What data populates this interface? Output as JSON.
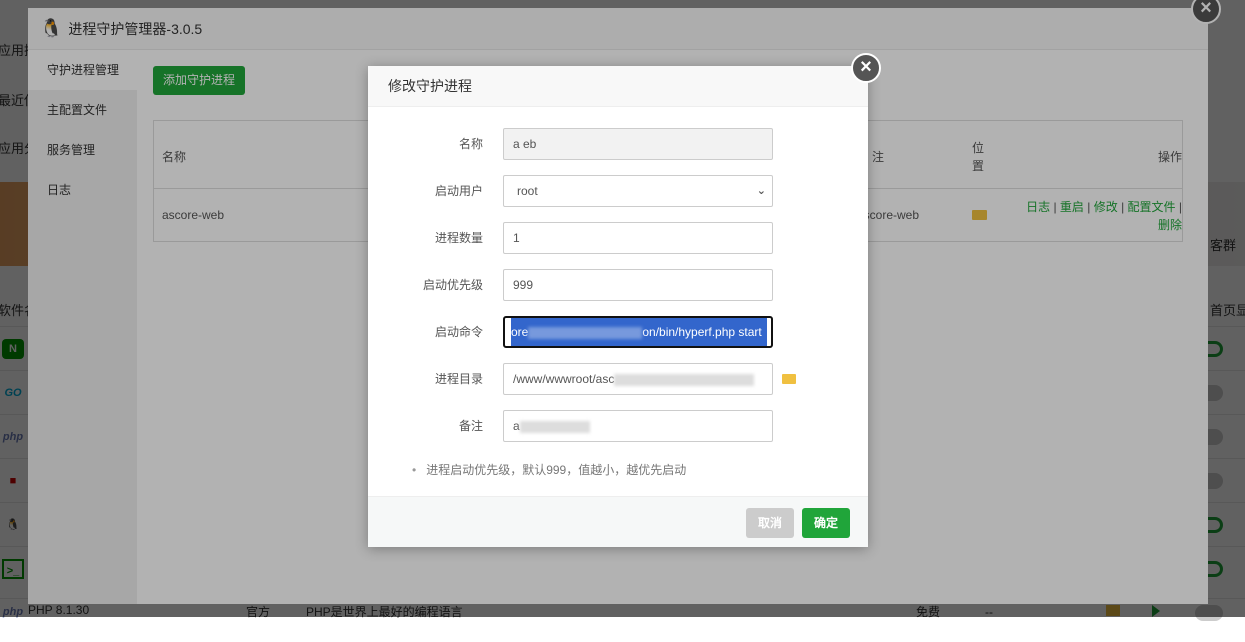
{
  "background": {
    "left_labels": [
      "应用搜索",
      "最近使用",
      "应用分类"
    ],
    "banner_text": "客群（年",
    "column_software": "软件名称",
    "column_home": "首页显示",
    "soft_icons": [
      "nginx-icon",
      "go-icon",
      "php-icon",
      "redis-icon",
      "linux-icon",
      "terminal-icon"
    ],
    "soft_icon_text": [
      "N",
      "GO",
      "php",
      "■",
      "🐧",
      ">_"
    ],
    "toggles_on": [
      true,
      false,
      false,
      false,
      true,
      true
    ],
    "bottom_row": {
      "icon": "php",
      "name": "PHP 8.1.30",
      "type": "官方",
      "desc": "PHP是世界上最好的编程语言",
      "price": "免费",
      "expire": "--"
    }
  },
  "plugin": {
    "title": "进程守护管理器-3.0.5",
    "sidebar": [
      {
        "label": "守护进程管理",
        "active": true
      },
      {
        "label": "主配置文件"
      },
      {
        "label": "服务管理"
      },
      {
        "label": "日志"
      }
    ],
    "add_button": "添加守护进程",
    "table": {
      "headers": {
        "name": "名称",
        "remark": "注",
        "location": "位置",
        "actions": "操作"
      },
      "rows": [
        {
          "name": "ascore-web",
          "remark": "ascore-web",
          "actions": [
            "日志",
            "重启",
            "修改",
            "配置文件",
            "删除"
          ]
        }
      ]
    }
  },
  "dialog": {
    "title": "修改守护进程",
    "fields": {
      "name": {
        "label": "名称",
        "value": "a        eb"
      },
      "user": {
        "label": "启动用户",
        "value": "root"
      },
      "count": {
        "label": "进程数量",
        "value": "1"
      },
      "priority": {
        "label": "启动优先级",
        "value": "999"
      },
      "command": {
        "label": "启动命令",
        "value_prefix": "ore",
        "value_suffix": "on/bin/hyperf.php start"
      },
      "dir": {
        "label": "进程目录",
        "value": "/www/wwwroot/asc"
      },
      "remark": {
        "label": "备注",
        "value": "a"
      }
    },
    "tip": "进程启动优先级，默认999，值越小，越优先启动",
    "cancel": "取消",
    "confirm": "确定"
  },
  "colors": {
    "accent": "#20a53a",
    "selection": "#3366cc",
    "folder": "#f0c040"
  }
}
